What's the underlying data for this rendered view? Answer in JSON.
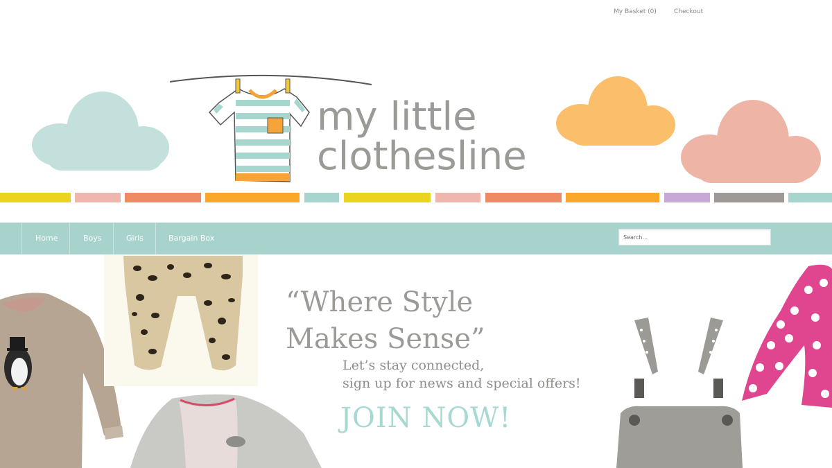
{
  "top_links": {
    "basket": "My Basket (0)",
    "checkout": "Checkout"
  },
  "logo": {
    "line1": "my little",
    "line2": "clothesline"
  },
  "nav": {
    "items": [
      {
        "label": "Home"
      },
      {
        "label": "Boys"
      },
      {
        "label": "Girls"
      },
      {
        "label": "Bargain Box"
      }
    ],
    "search_placeholder": "Search..."
  },
  "hero": {
    "quote_line1": "“Where Style",
    "quote_line2": "Makes Sense”",
    "sub_line1": "Let’s stay connected,",
    "sub_line2": "sign up for news and special offers!",
    "cta": "JOIN NOW!"
  },
  "colors": {
    "nav_bg": "#a8d3cc",
    "logo_text": "#9c9a96",
    "cta": "#a8d8d2",
    "cloud_teal": "#c3e0dc",
    "cloud_orange": "#fbbf6c",
    "cloud_pink": "#eeb5a7"
  },
  "images": {
    "tshirt": "striped-tshirt-on-clothesline",
    "sweater": "penguin-sweater",
    "leggings": "leopard-leggings",
    "top": "grey-raglan-top",
    "dungarees": "grey-dungarees",
    "jacket": "pink-polka-dot-jacket"
  }
}
